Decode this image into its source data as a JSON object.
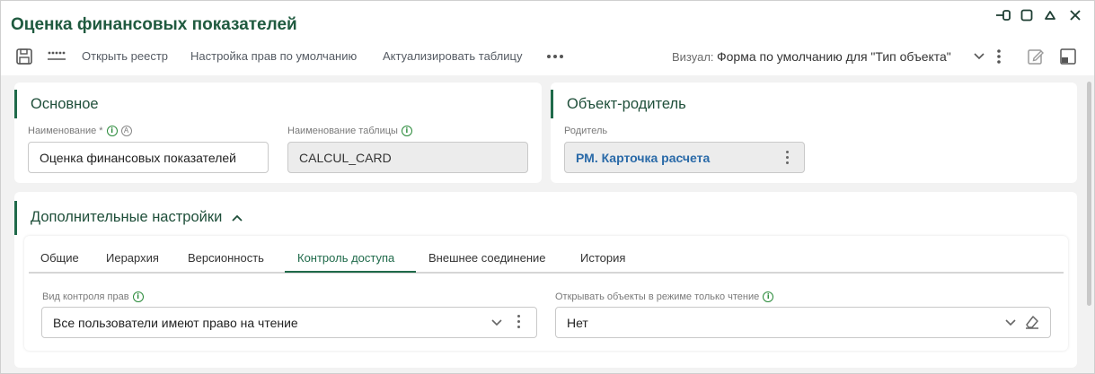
{
  "window": {
    "title": "Оценка финансовых показателей"
  },
  "toolbar": {
    "open_registry": "Открыть реестр",
    "default_rights": "Настройка прав по умолчанию",
    "refresh_table": "Актуализировать таблицу",
    "visual_label": "Визуал:",
    "visual_value": "Форма по умолчанию для \"Тип объекта\""
  },
  "main": {
    "title": "Основное",
    "name_label": "Наименование *",
    "name_value": "Оценка финансовых показателей",
    "table_label": "Наименование таблицы",
    "table_value": "CALCUL_CARD"
  },
  "parent": {
    "title": "Объект-родитель",
    "label": "Родитель",
    "value": "РМ. Карточка расчета"
  },
  "extra": {
    "title": "Дополнительные настройки",
    "tabs": [
      "Общие",
      "Иерархия",
      "Версионность",
      "Контроль доступа",
      "Внешнее соединение",
      "История"
    ],
    "active_tab": "Контроль доступа",
    "rights_label": "Вид контроля прав",
    "rights_value": "Все пользователи имеют право на чтение",
    "readonly_label": "Открывать объекты в режиме только чтение",
    "readonly_value": "Нет"
  },
  "colors": {
    "accent": "#1f6a4a",
    "info": "#2a8a3a",
    "link": "#2a6aa8"
  }
}
